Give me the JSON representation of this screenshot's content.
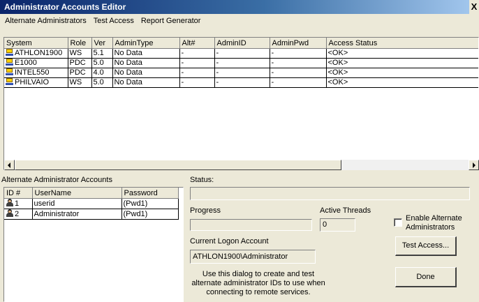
{
  "window": {
    "title": "Administrator Accounts Editor",
    "close_glyph": "X"
  },
  "menu": [
    "Alternate Administrators",
    "Test Access",
    "Report Generator"
  ],
  "systems": {
    "columns": [
      "System",
      "Role",
      "Ver",
      "AdminType",
      "Alt#",
      "AdminID",
      "AdminPwd",
      "Access Status"
    ],
    "rows": [
      {
        "system": "ATHLON1900",
        "role": "WS",
        "ver": "5.1",
        "admintype": "No Data",
        "alt": "-",
        "adminid": "-",
        "adminpwd": "-",
        "status": "<OK>"
      },
      {
        "system": "E1000",
        "role": "PDC",
        "ver": "5.0",
        "admintype": "No Data",
        "alt": "-",
        "adminid": "-",
        "adminpwd": "-",
        "status": "<OK>"
      },
      {
        "system": "INTEL550",
        "role": "PDC",
        "ver": "4.0",
        "admintype": "No Data",
        "alt": "-",
        "adminid": "-",
        "adminpwd": "-",
        "status": "<OK>"
      },
      {
        "system": "PHILVAIO",
        "role": "WS",
        "ver": "5.0",
        "admintype": "No Data",
        "alt": "-",
        "adminid": "-",
        "adminpwd": "-",
        "status": "<OK>"
      }
    ]
  },
  "alt_accounts": {
    "label": "Alternate Administrator Accounts",
    "columns": [
      "ID #",
      "UserName",
      "Password"
    ],
    "rows": [
      {
        "id": "1",
        "username": "userid",
        "password": "(Pwd1)"
      },
      {
        "id": "2",
        "username": "Administrator",
        "password": "(Pwd1)"
      }
    ]
  },
  "status": {
    "label": "Status:",
    "value": ""
  },
  "progress": {
    "label": "Progress",
    "fraction": 0
  },
  "threads": {
    "label": "Active Threads",
    "value": "0"
  },
  "enable_alt": {
    "label_line1": "Enable Alternate",
    "label_line2": "Administrators",
    "checked": false
  },
  "logon": {
    "label": "Current Logon Account",
    "value": "ATHLON1900\\Administrator"
  },
  "buttons": {
    "test_access": "Test Access...",
    "done": "Done"
  },
  "help_text": {
    "line1": "Use this dialog to create and test",
    "line2": "alternate administrator IDs to use when",
    "line3": "connecting to remote services."
  }
}
